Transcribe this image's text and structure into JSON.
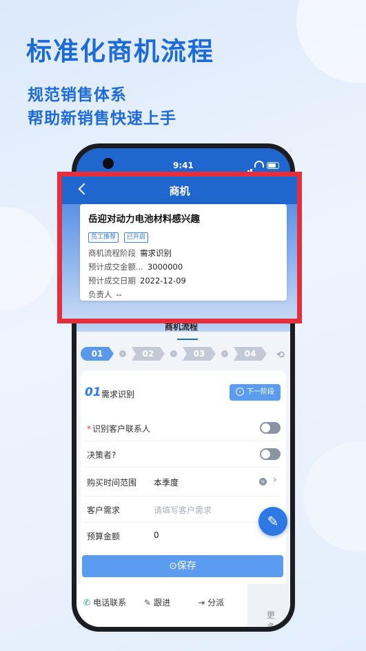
{
  "promo": {
    "headline": "标准化商机流程",
    "sub1": "规范销售体系",
    "sub2": "帮助新销售快速上手"
  },
  "status": {
    "time": "9:41"
  },
  "nav": {
    "title": "商机"
  },
  "opportunity": {
    "title": "岳迎对动力电池材料感兴趣",
    "tags": [
      "员工推荐",
      "已开启"
    ],
    "fields": [
      {
        "label": "商机流程阶段",
        "value": "需求识别"
      },
      {
        "label": "预计成交金额...",
        "value": "3000000"
      },
      {
        "label": "预计成交日期",
        "value": "2022-12-09"
      },
      {
        "label": "负责人",
        "value": "--"
      }
    ]
  },
  "tabs": {
    "active": "商机流程"
  },
  "steps": [
    "01",
    "02",
    "03",
    "04"
  ],
  "stage": {
    "number": "01",
    "name": "需求识别",
    "next_label": "下一阶段"
  },
  "form": {
    "identify_contact": "识别客户联系人",
    "decision_maker": "决策者?",
    "purchase_time_label": "购买时间范围",
    "purchase_time_value": "本季度",
    "needs_label": "客户需求",
    "needs_placeholder": "请填写客户需求",
    "budget_label": "预算金额",
    "budget_value": "0"
  },
  "save_label": "保存",
  "bottom_nav": {
    "call": "电话联系",
    "follow": "跟进",
    "assign": "分派",
    "more": "更多"
  },
  "colors": {
    "primary": "#1f66cf",
    "highlight": "#e52d3b",
    "button": "#5b9cf0"
  }
}
